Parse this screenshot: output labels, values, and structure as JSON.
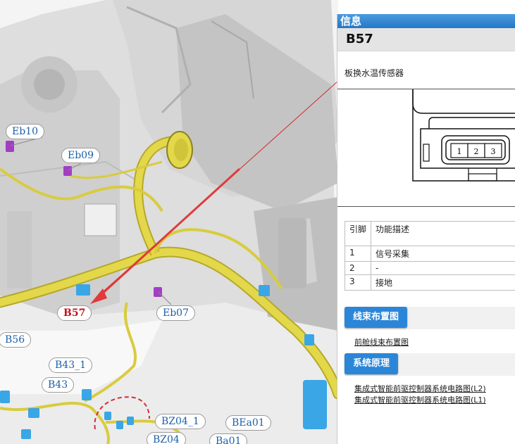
{
  "callouts": {
    "eb10": "Eb10",
    "eb09": "Eb09",
    "b57": "B57",
    "eb07": "Eb07",
    "b56": "B56",
    "b43_1": "B43_1",
    "b43": "B43",
    "bz04_1": "BZ04_1",
    "bz04": "BZ04",
    "bea01": "BEa01",
    "ba01": "Ba01"
  },
  "panel": {
    "header": "信息",
    "code": "B57",
    "description": "板换水温传感器",
    "connector_pins": [
      "1",
      "2",
      "3"
    ],
    "table": {
      "headers": [
        "引脚",
        "功能描述"
      ],
      "rows": [
        {
          "pin": "1",
          "func": "信号采集"
        },
        {
          "pin": "2",
          "func": "-"
        },
        {
          "pin": "3",
          "func": "接地"
        }
      ]
    },
    "harness_section": {
      "button": "线束布置图",
      "links": [
        "前舱线束布置图"
      ]
    },
    "schematic_section": {
      "button": "系统原理",
      "links": [
        "集成式智能前驱控制器系统电路图(L2)",
        "集成式智能前驱控制器系统电路图(L1)"
      ]
    }
  },
  "colors": {
    "accent": "#2b86d8",
    "highlight": "#c0141c",
    "harness": "#e3d84a",
    "connector": "#3aa6e6"
  }
}
